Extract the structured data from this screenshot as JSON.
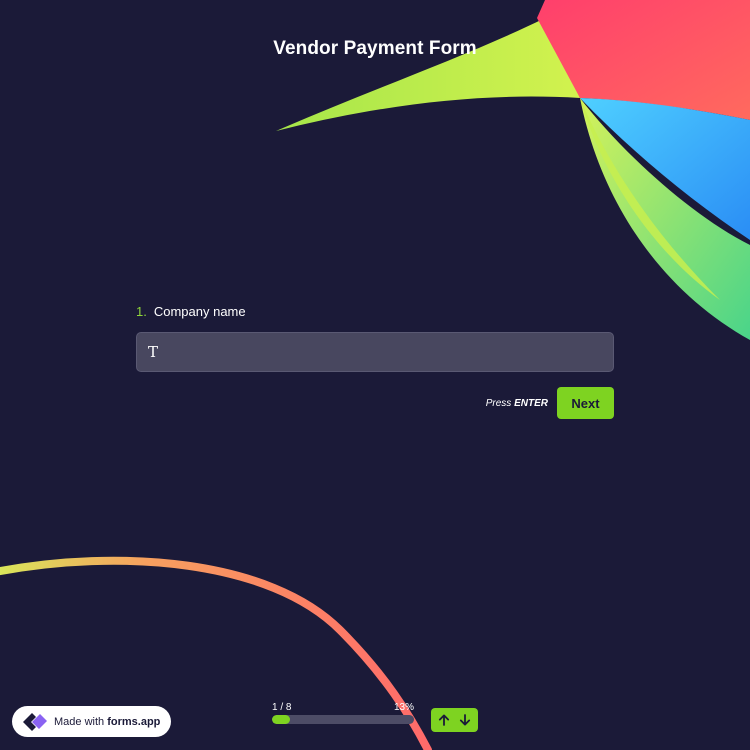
{
  "form": {
    "title": "Vendor Payment Form"
  },
  "question": {
    "number": "1.",
    "label": "Company name",
    "value": "",
    "cursor_glyph": "T"
  },
  "actions": {
    "press_prefix": "Press",
    "press_key": "ENTER",
    "next_label": "Next"
  },
  "progress": {
    "step_text": "1 / 8",
    "percent_text": "13%",
    "percent": 13
  },
  "badge": {
    "prefix": "Made with",
    "brand": "forms.app"
  },
  "colors": {
    "background": "#1b1a38",
    "accent": "#7ed321",
    "input_bg": "#48475f"
  },
  "icons": {
    "cursor": "text-cursor-icon",
    "up": "arrow-up-icon",
    "down": "arrow-down-icon",
    "logo": "forms-app-logo-icon"
  }
}
